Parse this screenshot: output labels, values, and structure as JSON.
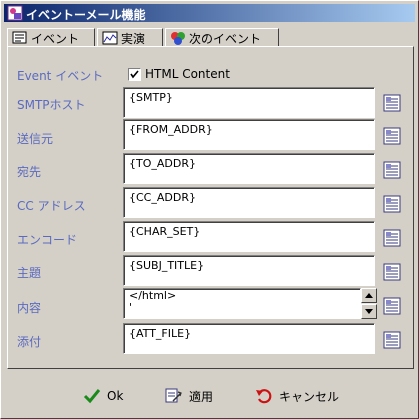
{
  "window": {
    "title": "イベントーメール機能",
    "icon": "app-icon"
  },
  "tabs": [
    {
      "label": "イベント",
      "icon": "event-tab-icon"
    },
    {
      "label": "実演",
      "icon": "demo-tab-icon"
    },
    {
      "label": "次のイベント",
      "icon": "next-event-tab-icon"
    }
  ],
  "form": {
    "event_label": "Event イベント",
    "html_content_label": "HTML Content",
    "html_content_checked": true,
    "rows": [
      {
        "label": "SMTPホスト",
        "value": "{SMTP}"
      },
      {
        "label": "送信元",
        "value": "{FROM_ADDR}"
      },
      {
        "label": "宛先",
        "value": "{TO_ADDR}"
      },
      {
        "label": "CC アドレス",
        "value": "{CC_ADDR}"
      },
      {
        "label": "エンコード",
        "value": "{CHAR_SET}"
      },
      {
        "label": "主題",
        "value": "{SUBJ_TITLE}"
      },
      {
        "label": "内容",
        "value": "</html>\n'"
      },
      {
        "label": "添付",
        "value": "{ATT_FILE}"
      }
    ]
  },
  "buttons": {
    "ok": "Ok",
    "apply": "適用",
    "cancel": "キャンセル"
  },
  "colors": {
    "label": "#5b6abf",
    "title_gradient_start": "#0a246a",
    "title_gradient_end": "#a6caf0",
    "ok_check": "#1a8a1a",
    "cancel_arrow": "#cc1111"
  }
}
